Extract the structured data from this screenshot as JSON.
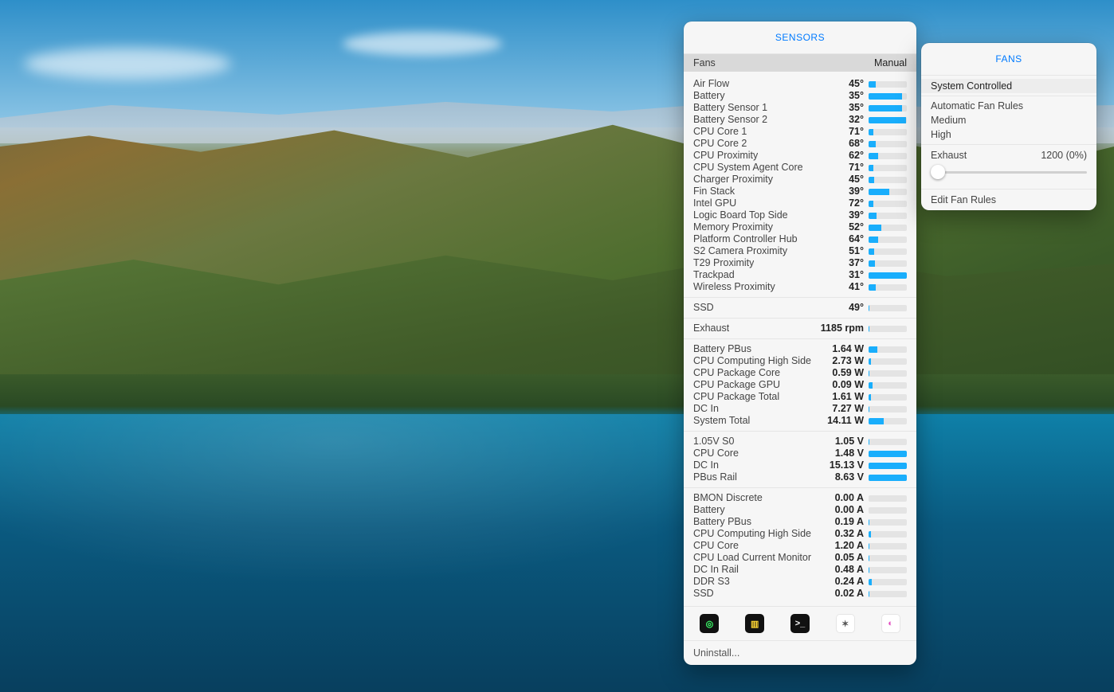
{
  "sensors_panel": {
    "title": "SENSORS",
    "sub_left": "Fans",
    "sub_right": "Manual",
    "uninstall": "Uninstall..."
  },
  "temps": [
    {
      "label": "Air Flow",
      "value": "45°",
      "pct": 18
    },
    {
      "label": "Battery",
      "value": "35°",
      "pct": 88
    },
    {
      "label": "Battery Sensor 1",
      "value": "35°",
      "pct": 88
    },
    {
      "label": "Battery Sensor 2",
      "value": "32°",
      "pct": 98
    },
    {
      "label": "CPU Core 1",
      "value": "71°",
      "pct": 12
    },
    {
      "label": "CPU Core 2",
      "value": "68°",
      "pct": 18
    },
    {
      "label": "CPU Proximity",
      "value": "62°",
      "pct": 24
    },
    {
      "label": "CPU System Agent Core",
      "value": "71°",
      "pct": 12
    },
    {
      "label": "Charger Proximity",
      "value": "45°",
      "pct": 14
    },
    {
      "label": "Fin Stack",
      "value": "39°",
      "pct": 54
    },
    {
      "label": "Intel GPU",
      "value": "72°",
      "pct": 12
    },
    {
      "label": "Logic Board Top Side",
      "value": "39°",
      "pct": 20
    },
    {
      "label": "Memory Proximity",
      "value": "52°",
      "pct": 34
    },
    {
      "label": "Platform Controller Hub",
      "value": "64°",
      "pct": 26
    },
    {
      "label": "S2 Camera Proximity",
      "value": "51°",
      "pct": 14
    },
    {
      "label": "T29 Proximity",
      "value": "37°",
      "pct": 16
    },
    {
      "label": "Trackpad",
      "value": "31°",
      "pct": 100
    },
    {
      "label": "Wireless Proximity",
      "value": "41°",
      "pct": 18
    }
  ],
  "ssd": [
    {
      "label": "SSD",
      "value": "49°",
      "pct": 3
    }
  ],
  "fans_readout": [
    {
      "label": "Exhaust",
      "value": "1185 rpm",
      "pct": 3
    }
  ],
  "power": [
    {
      "label": "Battery PBus",
      "value": "1.64 W",
      "pct": 22
    },
    {
      "label": "CPU Computing High Side",
      "value": "2.73 W",
      "pct": 6
    },
    {
      "label": "CPU Package Core",
      "value": "0.59 W",
      "pct": 2
    },
    {
      "label": "CPU Package GPU",
      "value": "0.09 W",
      "pct": 10
    },
    {
      "label": "CPU Package Total",
      "value": "1.61 W",
      "pct": 6
    },
    {
      "label": "DC In",
      "value": "7.27 W",
      "pct": 3
    },
    {
      "label": "System Total",
      "value": "14.11 W",
      "pct": 40
    }
  ],
  "voltage": [
    {
      "label": "1.05V S0",
      "value": "1.05 V",
      "pct": 3
    },
    {
      "label": "CPU Core",
      "value": "1.48 V",
      "pct": 100
    },
    {
      "label": "DC In",
      "value": "15.13 V",
      "pct": 100
    },
    {
      "label": "PBus Rail",
      "value": "8.63 V",
      "pct": 100
    }
  ],
  "current": [
    {
      "label": "BMON Discrete",
      "value": "0.00 A",
      "pct": 0
    },
    {
      "label": "Battery",
      "value": "0.00 A",
      "pct": 0
    },
    {
      "label": "Battery PBus",
      "value": "0.19 A",
      "pct": 2
    },
    {
      "label": "CPU Computing High Side",
      "value": "0.32 A",
      "pct": 6
    },
    {
      "label": "CPU Core",
      "value": "1.20 A",
      "pct": 2
    },
    {
      "label": "CPU Load Current Monitor",
      "value": "0.05 A",
      "pct": 2
    },
    {
      "label": "DC In Rail",
      "value": "0.48 A",
      "pct": 2
    },
    {
      "label": "DDR S3",
      "value": "0.24 A",
      "pct": 8
    },
    {
      "label": "SSD",
      "value": "0.02 A",
      "pct": 2
    }
  ],
  "app_icons": [
    {
      "name": "activity-monitor-icon",
      "bg": "act",
      "glyph": "◎",
      "color": "#3cff6a"
    },
    {
      "name": "amphetamine-icon",
      "bg": "amph",
      "glyph": "▥",
      "color": "#ffd633"
    },
    {
      "name": "terminal-icon",
      "bg": "term",
      "glyph": ">_",
      "color": "#fff"
    },
    {
      "name": "cleanup-icon",
      "bg": "clean",
      "glyph": "✶",
      "color": "#555"
    },
    {
      "name": "speedtest-icon",
      "bg": "speed",
      "glyph": "◐",
      "color": "#e24cc0"
    }
  ],
  "fans_panel": {
    "title": "FANS",
    "system": "System Controlled",
    "auto": "Automatic Fan Rules",
    "medium": "Medium",
    "high": "High",
    "exhaust_label": "Exhaust",
    "exhaust_value": "1200 (0%)",
    "edit": "Edit Fan Rules"
  }
}
